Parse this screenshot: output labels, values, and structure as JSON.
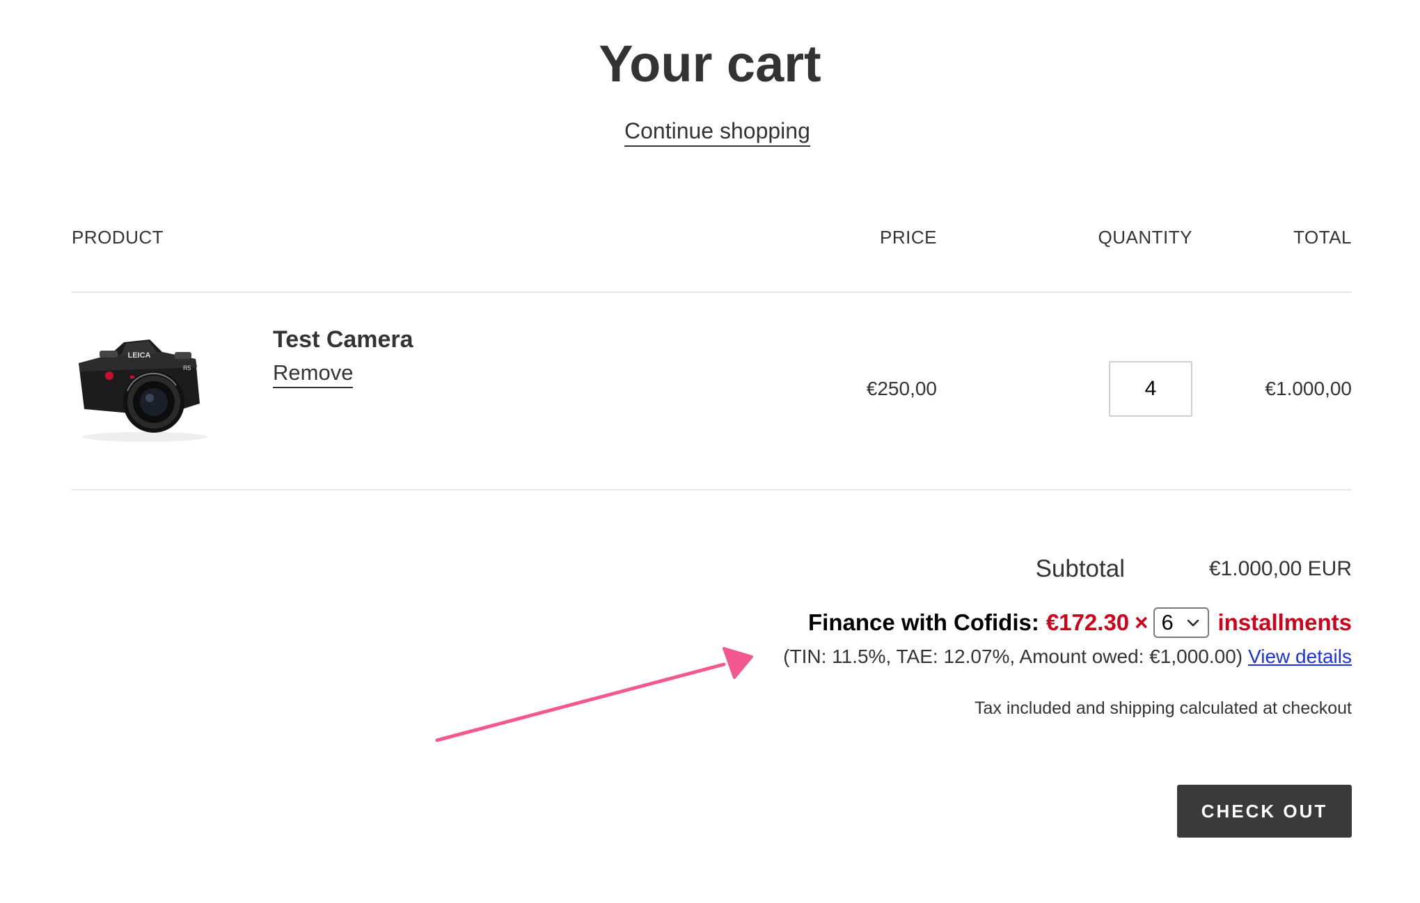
{
  "header": {
    "title": "Your cart",
    "continue_label": "Continue shopping"
  },
  "table": {
    "columns": [
      "PRODUCT",
      "PRICE",
      "QUANTITY",
      "TOTAL"
    ]
  },
  "items": [
    {
      "name": "Test Camera",
      "remove_label": "Remove",
      "price": "€250,00",
      "quantity": "4",
      "total": "€1.000,00",
      "image_icon": "camera-icon",
      "image_brand_text": "LEICA",
      "image_model_text": "R5"
    }
  ],
  "summary": {
    "subtotal_label": "Subtotal",
    "subtotal_value": "€1.000,00 EUR",
    "finance": {
      "label": "Finance with Cofidis:",
      "amount": "€172.30",
      "times": "×",
      "selected_installments": "6",
      "installments_label": "installments",
      "terms": "(TIN: 11.5%, TAE: 12.07%, Amount owed: €1,000.00)",
      "details_link": "View details"
    },
    "tax_note": "Tax included and shipping calculated at checkout",
    "checkout_label": "CHECK OUT"
  },
  "annotation": {
    "icon": "arrow-icon",
    "color": "#f2578f"
  },
  "colors": {
    "text": "#333333",
    "finance_accent": "#d0021b",
    "link": "#1a30e8",
    "button_bg": "#3a3a3a",
    "divider": "#e8e8e8"
  }
}
